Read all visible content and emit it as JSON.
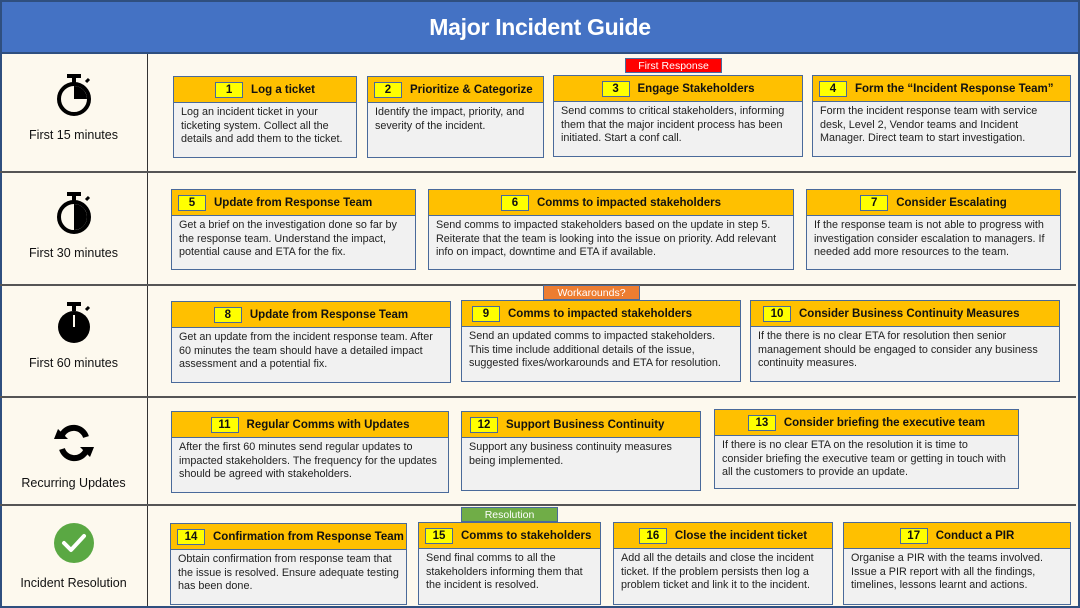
{
  "title": "Major Incident Guide",
  "colors": {
    "header_bg": "#4472c4",
    "card_header": "#ffc000",
    "number_badge": "#ffff00",
    "card_body": "#f1f1f1",
    "tag_first_response": "#ff0000",
    "tag_workarounds": "#ed7d31",
    "tag_resolution": "#70ad47",
    "check_green": "#5aa843"
  },
  "phases": [
    {
      "label": "First 15 minutes",
      "icon": "stopwatch-quarter-icon"
    },
    {
      "label": "First 30 minutes",
      "icon": "stopwatch-half-icon"
    },
    {
      "label": "First 60 minutes",
      "icon": "stopwatch-full-icon"
    },
    {
      "label": "Recurring Updates",
      "icon": "refresh-icon"
    },
    {
      "label": "Incident Resolution",
      "icon": "check-circle-icon"
    }
  ],
  "tags": {
    "first_response": "First Response",
    "workarounds": "Workarounds?",
    "resolution": "Resolution"
  },
  "steps": [
    {
      "num": "1",
      "title": "Log a ticket",
      "body": "Log an incident ticket in your ticketing system. Collect all the details and add them to the ticket."
    },
    {
      "num": "2",
      "title": "Prioritize & Categorize",
      "body": "Identify the impact, priority, and severity of the incident."
    },
    {
      "num": "3",
      "title": "Engage  Stakeholders",
      "body": "Send comms to critical stakeholders, informing them that the major incident process has been initiated. Start a conf call."
    },
    {
      "num": "4",
      "title": "Form the “Incident Response  Team”",
      "body": "Form the incident response team with service desk, Level  2, Vendor teams and Incident Manager.  Direct team to start investigation."
    },
    {
      "num": "5",
      "title": "Update from  Response  Team",
      "body": "Get a brief on the investigation done so far by the response team. Understand the impact, potential cause and ETA for the fix."
    },
    {
      "num": "6",
      "title": "Comms to impacted stakeholders",
      "body": "Send comms to impacted stakeholders based on the update in step 5. Reiterate that the team is looking into the issue on priority.  Add relevant  info on impact, downtime and ETA if available."
    },
    {
      "num": "7",
      "title": "Consider  Escalating",
      "body": "If the response team is not able to progress with investigation  consider escalation to managers.  If needed  add more resources to the team."
    },
    {
      "num": "8",
      "title": "Update from  Response  Team",
      "body": "Get an update from the incident response team. After 60 minutes the team should have  a detailed impact assessment and a potential fix."
    },
    {
      "num": "9",
      "title": "Comms to impacted stakeholders",
      "body": "Send an updated comms to impacted stakeholders. This time include additional  details of the issue, suggested fixes/workarounds  and ETA for resolution."
    },
    {
      "num": "10",
      "title": "Consider Business  Continuity  Measures",
      "body": "If the there is no clear ETA for resolution then senior management  should be engaged to consider any business continuity measures."
    },
    {
      "num": "11",
      "title": "Regular Comms  with Updates",
      "body": "After the first 60 minutes send regular updates to impacted stakeholders. The frequency for the updates should be agreed with stakeholders."
    },
    {
      "num": "12",
      "title": "Support Business  Continuity",
      "body": "Support  any business continuity measures being implemented."
    },
    {
      "num": "13",
      "title": "Consider  briefing the executive team",
      "body": "If there is no clear ETA on the resolution it is time to consider briefing the executive  team or getting in touch with all the customers to provide  an update."
    },
    {
      "num": "14",
      "title": "Confirmation from Response Team",
      "body": "Obtain confirmation from response team that the issue is resolved.  Ensure adequate testing has been done."
    },
    {
      "num": "15",
      "title": "Comms to stakeholders",
      "body": "Send final comms to all the stakeholders informing them that the incident is resolved."
    },
    {
      "num": "16",
      "title": "Close the incident ticket",
      "body": "Add all the details and close the incident ticket. If the problem  persists then log a problem  ticket and link it to the incident."
    },
    {
      "num": "17",
      "title": "Conduct  a PIR",
      "body": "Organise a PIR with the teams involved. Issue a PIR report with all the findings, timelines, lessons learnt and actions."
    }
  ]
}
